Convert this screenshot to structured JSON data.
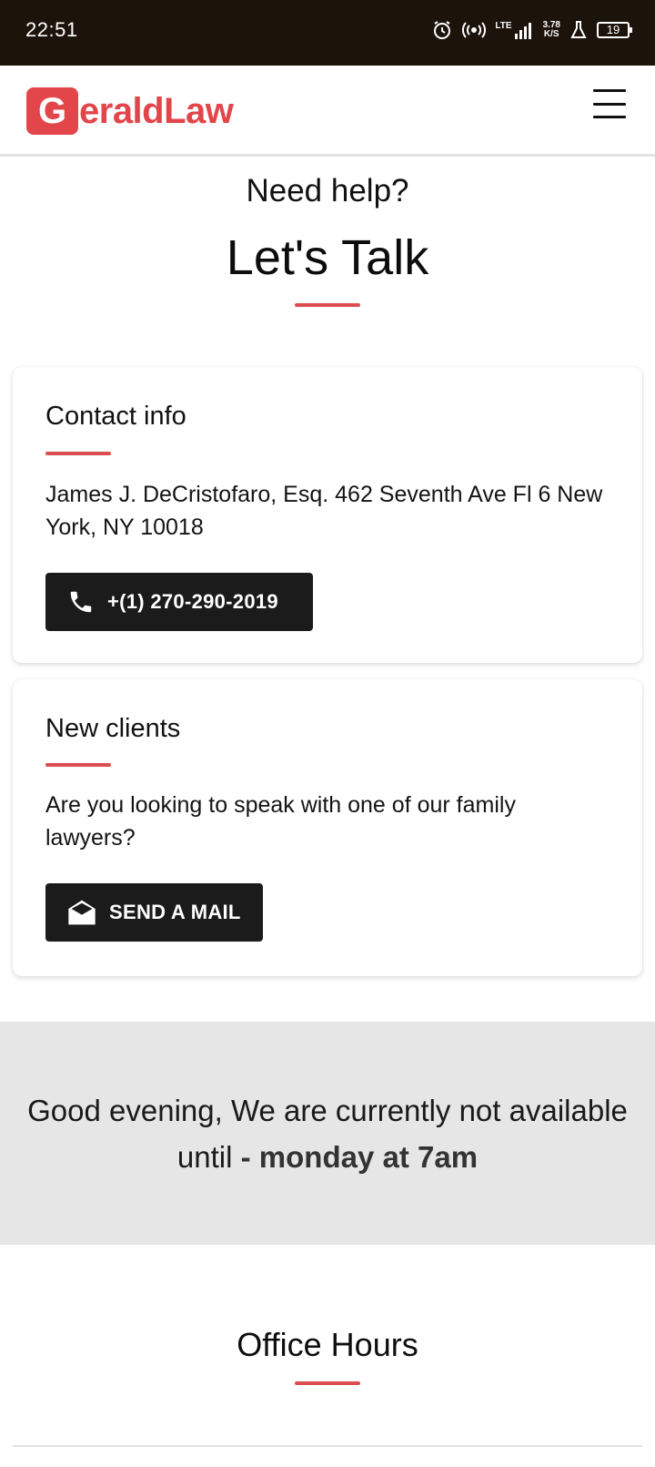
{
  "status_bar": {
    "time": "22:51",
    "network": "LTE",
    "net_speed_value": "3.78",
    "net_speed_unit": "K/S",
    "battery": "19",
    "icons": [
      "alarm-icon",
      "hotspot-icon",
      "signal-icon",
      "lab-flask-icon",
      "battery-icon"
    ]
  },
  "header": {
    "logo_letter": "G",
    "logo_text": "eraldLaw",
    "brand_color": "#e2464a"
  },
  "hero": {
    "subtitle": "Need help?",
    "title": "Let's Talk",
    "accent_color": "#dc4d4f"
  },
  "contact_card": {
    "title": "Contact info",
    "address": "James J. DeCristofaro, Esq. 462 Seventh Ave Fl 6 New York, NY 10018",
    "phone_button": "+(1) 270-290-2019",
    "phone_icon": "phone-icon"
  },
  "clients_card": {
    "title": "New clients",
    "text": "Are you looking to speak with one of our family lawyers?",
    "mail_button": "SEND A MAIL",
    "mail_icon": "mail-open-icon"
  },
  "notice": {
    "text": "Good evening, We are currently not available until",
    "highlight": "- monday at 7am",
    "background": "#e6e6e6"
  },
  "office_hours": {
    "title": "Office Hours"
  }
}
